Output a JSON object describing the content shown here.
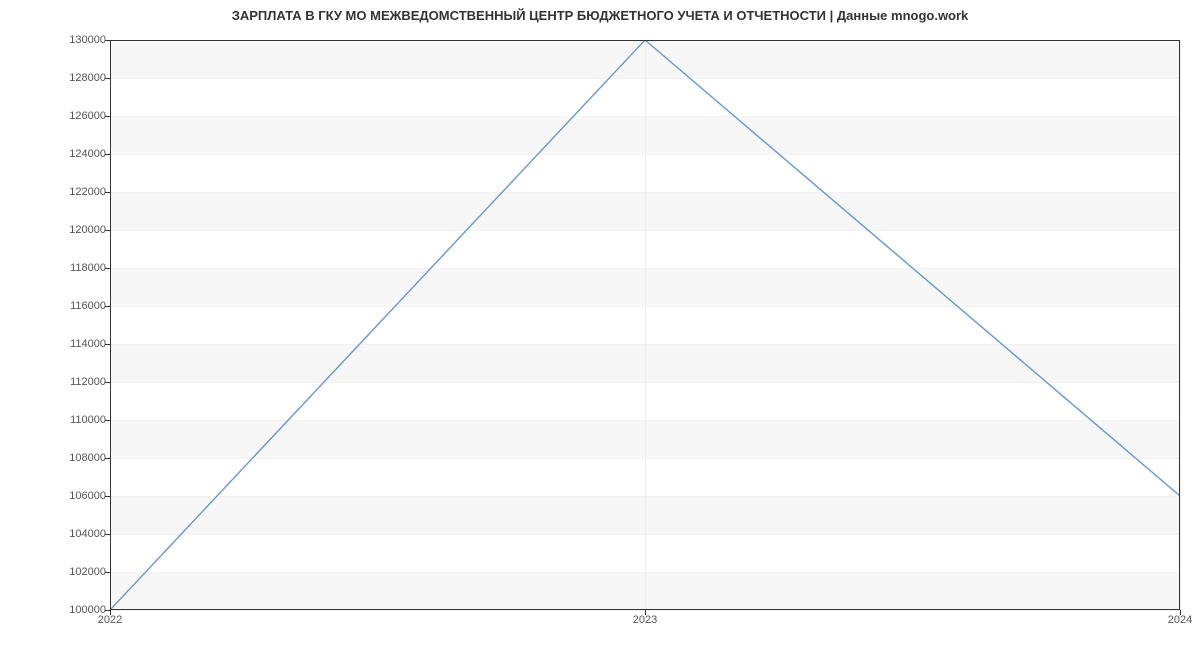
{
  "chart_data": {
    "type": "line",
    "title": "ЗАРПЛАТА В ГКУ МО МЕЖВЕДОМСТВЕННЫЙ ЦЕНТР БЮДЖЕТНОГО УЧЕТА И ОТЧЕТНОСТИ | Данные mnogo.work",
    "xlabel": "",
    "ylabel": "",
    "x_categories": [
      "2022",
      "2023",
      "2024"
    ],
    "x_positions": [
      0,
      1,
      2
    ],
    "series": [
      {
        "name": "salary",
        "values": [
          100000,
          130000,
          106000
        ]
      }
    ],
    "xlim": [
      0,
      2
    ],
    "ylim": [
      100000,
      130000
    ],
    "y_ticks": [
      100000,
      102000,
      104000,
      106000,
      108000,
      110000,
      112000,
      114000,
      116000,
      118000,
      120000,
      122000,
      124000,
      126000,
      128000,
      130000
    ],
    "x_ticks": [
      0,
      1,
      2
    ],
    "colors": {
      "line": "#6699cc"
    }
  }
}
